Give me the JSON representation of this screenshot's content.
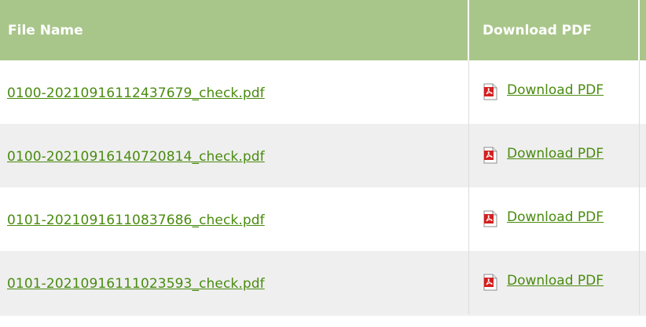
{
  "table": {
    "headers": {
      "file_name": "File Name",
      "download_pdf": "Download PDF"
    },
    "rows": [
      {
        "file_name": "0100-20210916112437679_check.pdf",
        "download_label": "Download PDF"
      },
      {
        "file_name": "0100-20210916140720814_check.pdf",
        "download_label": "Download PDF"
      },
      {
        "file_name": "0101-20210916110837686_check.pdf",
        "download_label": "Download PDF"
      },
      {
        "file_name": "0101-20210916111023593_check.pdf",
        "download_label": "Download PDF"
      }
    ],
    "icon": "pdf-file-icon",
    "colors": {
      "header_bg": "#a9c68a",
      "link": "#4a8b0f",
      "alt_row": "#efefef"
    }
  }
}
